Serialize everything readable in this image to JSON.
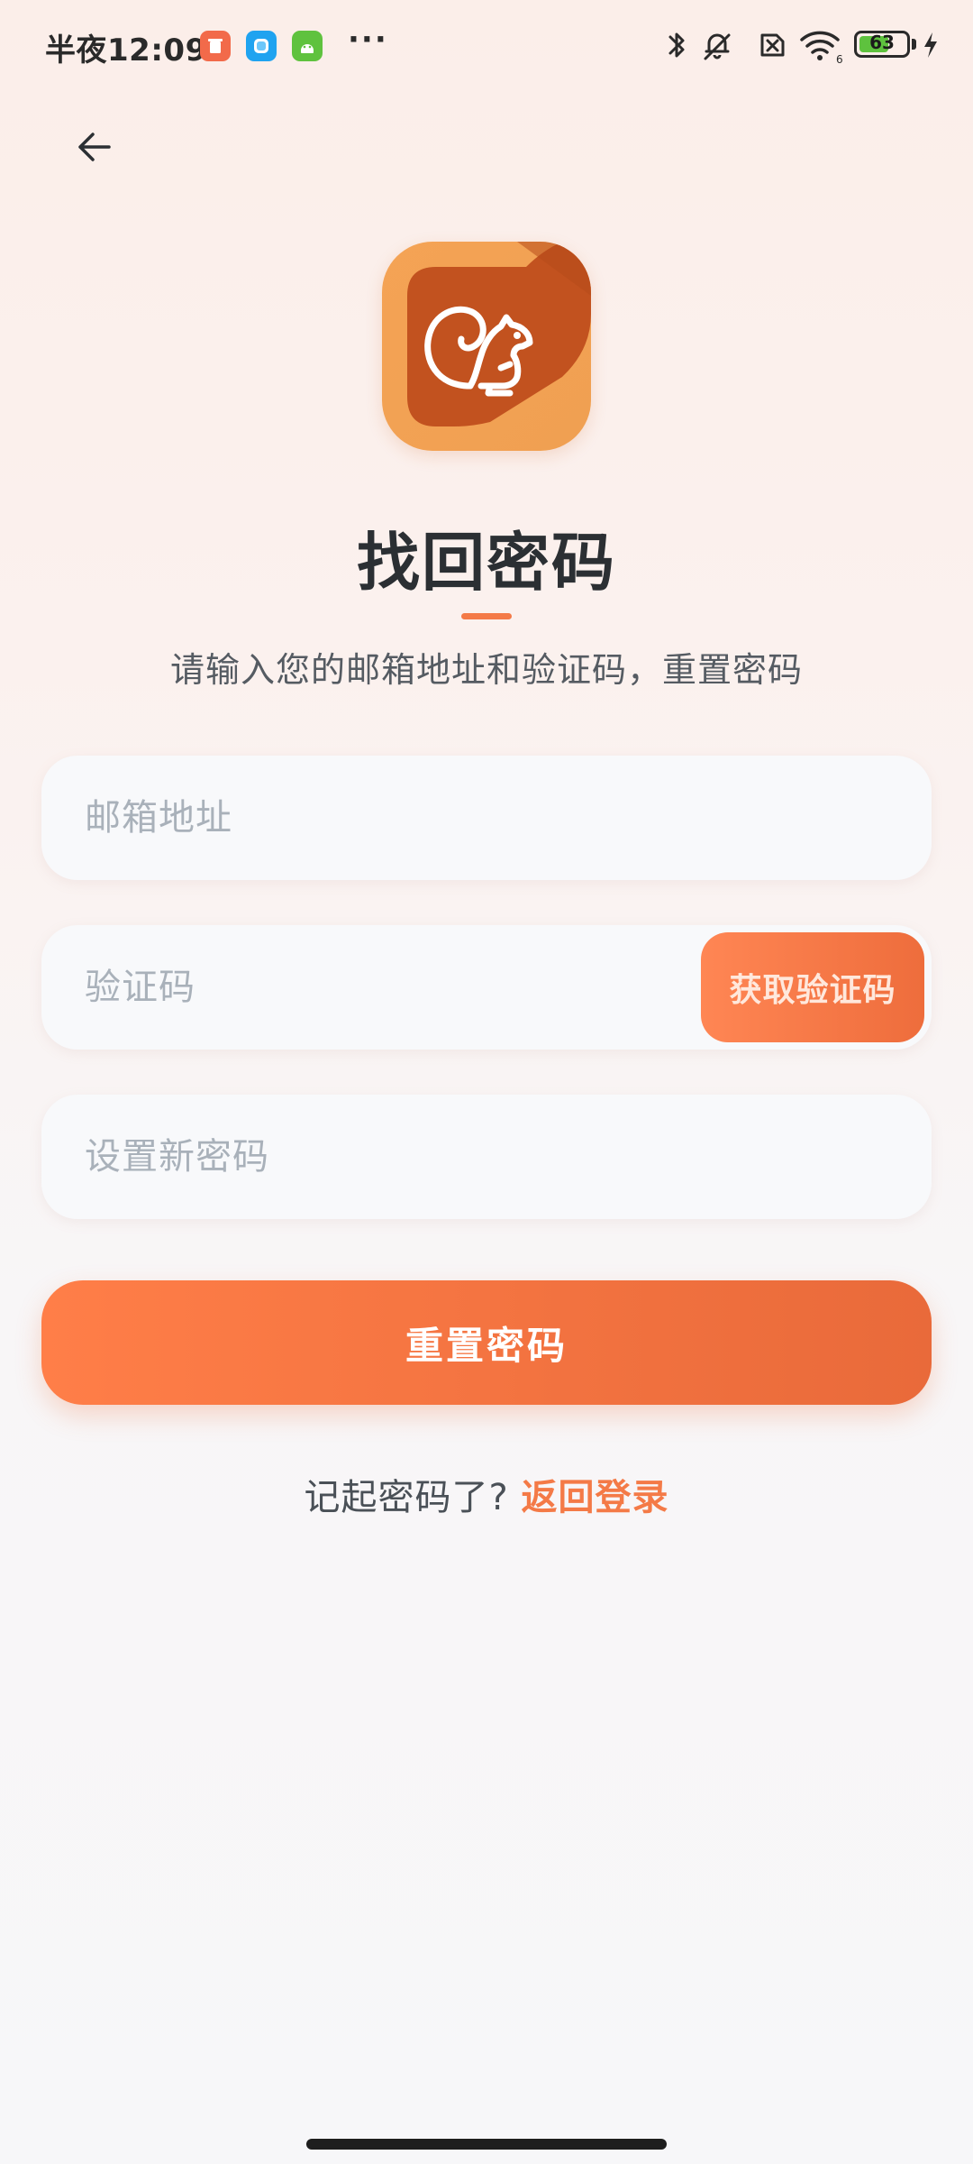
{
  "status_bar": {
    "time": "半夜12:09",
    "more": "···",
    "battery_level": "63",
    "battery_fraction": 0.63
  },
  "icons": {
    "back": "arrow-left-icon",
    "notif_1": "trash-app-icon",
    "notif_2": "chat-app-icon",
    "notif_3": "android-app-icon",
    "bluetooth": "bluetooth-icon",
    "mute": "bell-muted-icon",
    "no_sim": "no-sim-icon",
    "wifi": "wifi-icon",
    "charging": "charging-bolt-icon",
    "logo": "squirrel-logo-icon"
  },
  "colors": {
    "accent": "#f47a47",
    "button_start": "#ff7e48",
    "button_end": "#e96a3a",
    "logo_light": "#f3a152",
    "logo_dark": "#c2521f"
  },
  "header": {
    "title": "找回密码",
    "subtitle": "请输入您的邮箱地址和验证码，重置密码"
  },
  "form": {
    "email_placeholder": "邮箱地址",
    "code_placeholder": "验证码",
    "get_code_label": "获取验证码",
    "new_password_placeholder": "设置新密码",
    "reset_label": "重置密码"
  },
  "footer": {
    "prompt": "记起密码了? ",
    "link": "返回登录"
  }
}
